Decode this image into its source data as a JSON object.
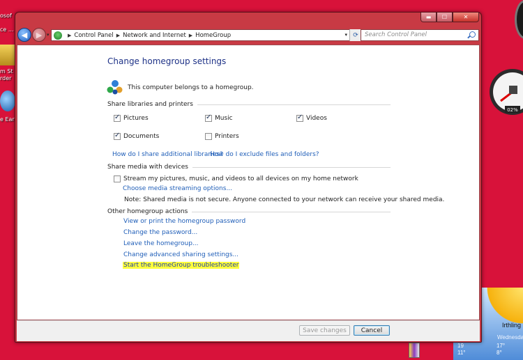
{
  "desktop": {
    "icon_labels": [
      "osof",
      "ce ...",
      "m St",
      "rder",
      "e Ear"
    ],
    "gauge_text": "02%",
    "weather": {
      "city": "Irthling",
      "day": "Wednesda",
      "temp_high": "17°",
      "temp_low": "8°",
      "small_high": "19",
      "small_low": "11°"
    }
  },
  "window": {
    "buttons": [
      "minimize",
      "maximize",
      "close"
    ],
    "address": {
      "crumbs": [
        "Control Panel",
        "Network and Internet",
        "HomeGroup"
      ],
      "icon": "control-panel-icon"
    },
    "search_placeholder": "Search Control Panel"
  },
  "page": {
    "title": "Change homegroup settings",
    "status": "This computer belongs to a homegroup.",
    "share_section": "Share libraries and printers",
    "checkboxes": [
      {
        "label": "Pictures",
        "checked": true
      },
      {
        "label": "Music",
        "checked": true
      },
      {
        "label": "Videos",
        "checked": true
      },
      {
        "label": "Documents",
        "checked": true
      },
      {
        "label": "Printers",
        "checked": false
      }
    ],
    "link_libraries": "How do I share additional libraries?",
    "link_exclude": "How do I exclude files and folders?",
    "media_section": "Share media with devices",
    "stream_label": "Stream my pictures, music, and videos to all devices on my home network",
    "stream_checked": false,
    "link_streaming": "Choose media streaming options...",
    "note": "Note: Shared media is not secure. Anyone connected to your network can receive your shared media.",
    "other_section": "Other homegroup actions",
    "actions": [
      "View or print the homegroup password",
      "Change the password...",
      "Leave the homegroup...",
      "Change advanced sharing settings...",
      "Start the HomeGroup troubleshooter"
    ],
    "save_label": "Save changes",
    "cancel_label": "Cancel"
  }
}
